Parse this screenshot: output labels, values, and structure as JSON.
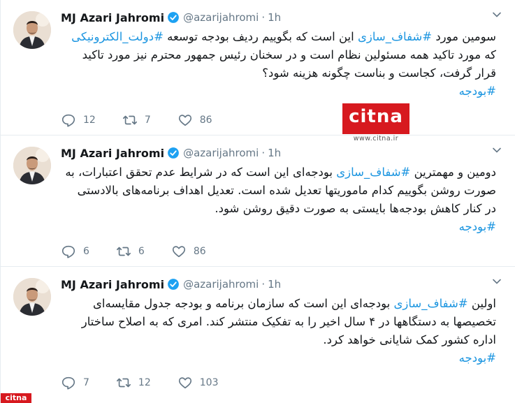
{
  "tweets": [
    {
      "author": "MJ Azari Jahromi",
      "handle": "@azarijahromi",
      "separator": "·",
      "time": "1h",
      "lines": [
        [
          {
            "text": "سومین مورد ",
            "tag": false
          },
          {
            "text": "#شفاف_سازی",
            "tag": true
          },
          {
            "text": " این است که بگوییم ردیف بودجه توسعه ",
            "tag": false
          },
          {
            "text": "#دولت_الکترونیکی",
            "tag": true
          }
        ],
        [
          {
            "text": "که مورد تاکید همه مسئولین نظام است و در سخنان رئیس جمهور محترم نیز مورد تاکید",
            "tag": false
          }
        ],
        [
          {
            "text": "قرار گرفت، کجاست و بناست چگونه هزینه شود؟",
            "tag": false
          }
        ],
        [
          {
            "text": "#بودجه",
            "tag": true
          }
        ]
      ],
      "replies": "12",
      "retweets": "7",
      "likes": "86"
    },
    {
      "author": "MJ Azari Jahromi",
      "handle": "@azarijahromi",
      "separator": "·",
      "time": "1h",
      "lines": [
        [
          {
            "text": "دومین و مهمترین ",
            "tag": false
          },
          {
            "text": "#شفاف_سازی",
            "tag": true
          },
          {
            "text": " بودجه‌ای این است که در شرایط عدم تحقق اعتبارات، به",
            "tag": false
          }
        ],
        [
          {
            "text": "صورت روشن بگوییم کدام ماموریتها تعدیل شده است. تعدیل اهداف برنامه‌های بالادستی",
            "tag": false
          }
        ],
        [
          {
            "text": "در کنار کاهش بودجه‌ها بایستی به صورت دقیق روشن شود.",
            "tag": false
          }
        ],
        [
          {
            "text": "#بودجه",
            "tag": true
          }
        ]
      ],
      "replies": "6",
      "retweets": "6",
      "likes": "86"
    },
    {
      "author": "MJ Azari Jahromi",
      "handle": "@azarijahromi",
      "separator": "·",
      "time": "1h",
      "lines": [
        [
          {
            "text": "اولین ",
            "tag": false
          },
          {
            "text": "#شفاف_سازی",
            "tag": true
          },
          {
            "text": " بودجه‌ای این است که سازمان برنامه و بودجه جدول مقایسه‌ای",
            "tag": false
          }
        ],
        [
          {
            "text": "تخصیصها به دستگاهها در ۴ سال اخیر را به تفکیک منتشر کند. امری که به اصلاح ساختار",
            "tag": false
          }
        ],
        [
          {
            "text": "اداره کشور کمک شایانی خواهد کرد.",
            "tag": false
          }
        ],
        [
          {
            "text": "#بودجه",
            "tag": true
          }
        ]
      ],
      "replies": "7",
      "retweets": "12",
      "likes": "103"
    }
  ],
  "icons": {
    "reply": "reply-icon",
    "retweet": "retweet-icon",
    "like": "heart-icon",
    "verified": "verified-badge-icon",
    "more": "chevron-down-icon"
  },
  "colors": {
    "text": "#14171a",
    "muted": "#657786",
    "hashtag": "#1b95e0",
    "verified": "#1da1f2",
    "divider": "#e6ecf0",
    "watermark": "#d7191f"
  },
  "watermark": {
    "logo_text": "citna",
    "url": "www.citna.ir",
    "corner_text": "citna"
  }
}
